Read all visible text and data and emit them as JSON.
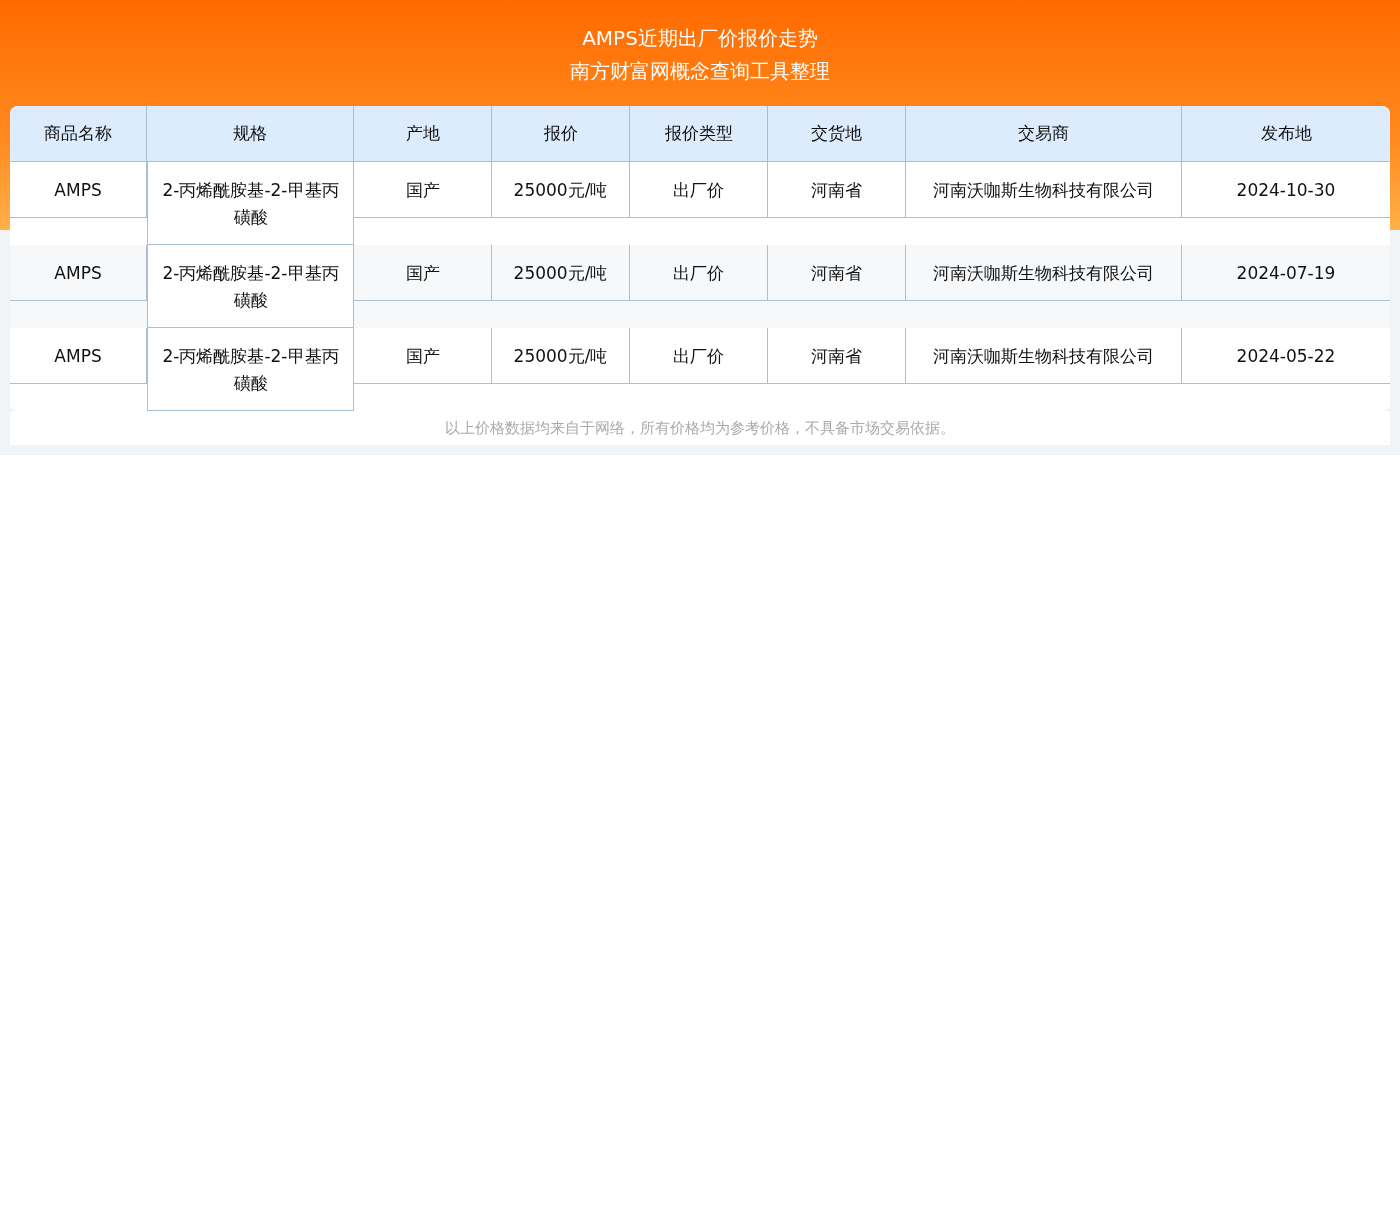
{
  "header": {
    "title": "AMPS近期出厂价报价走势",
    "subtitle": "南方财富网概念查询工具整理"
  },
  "table": {
    "columns": [
      "商品名称",
      "规格",
      "产地",
      "报价",
      "报价类型",
      "交货地",
      "交易商",
      "发布地"
    ],
    "rows": [
      {
        "cells": [
          "AMPS",
          "2-丙烯酰胺基-2-甲基丙磺酸",
          "国产",
          "25000元/吨",
          "出厂价",
          "河南省",
          "河南沃咖斯生物科技有限公司",
          "2024-10-30"
        ]
      },
      {
        "cells": [
          "AMPS",
          "2-丙烯酰胺基-2-甲基丙磺酸",
          "国产",
          "25000元/吨",
          "出厂价",
          "河南省",
          "河南沃咖斯生物科技有限公司",
          "2024-07-19"
        ]
      },
      {
        "cells": [
          "AMPS",
          "2-丙烯酰胺基-2-甲基丙磺酸",
          "国产",
          "25000元/吨",
          "出厂价",
          "河南省",
          "河南沃咖斯生物科技有限公司",
          "2024-05-22"
        ]
      }
    ]
  },
  "footnote": "以上价格数据均来自于网络，所有价格均为参考价格，不具备市场交易依据。"
}
